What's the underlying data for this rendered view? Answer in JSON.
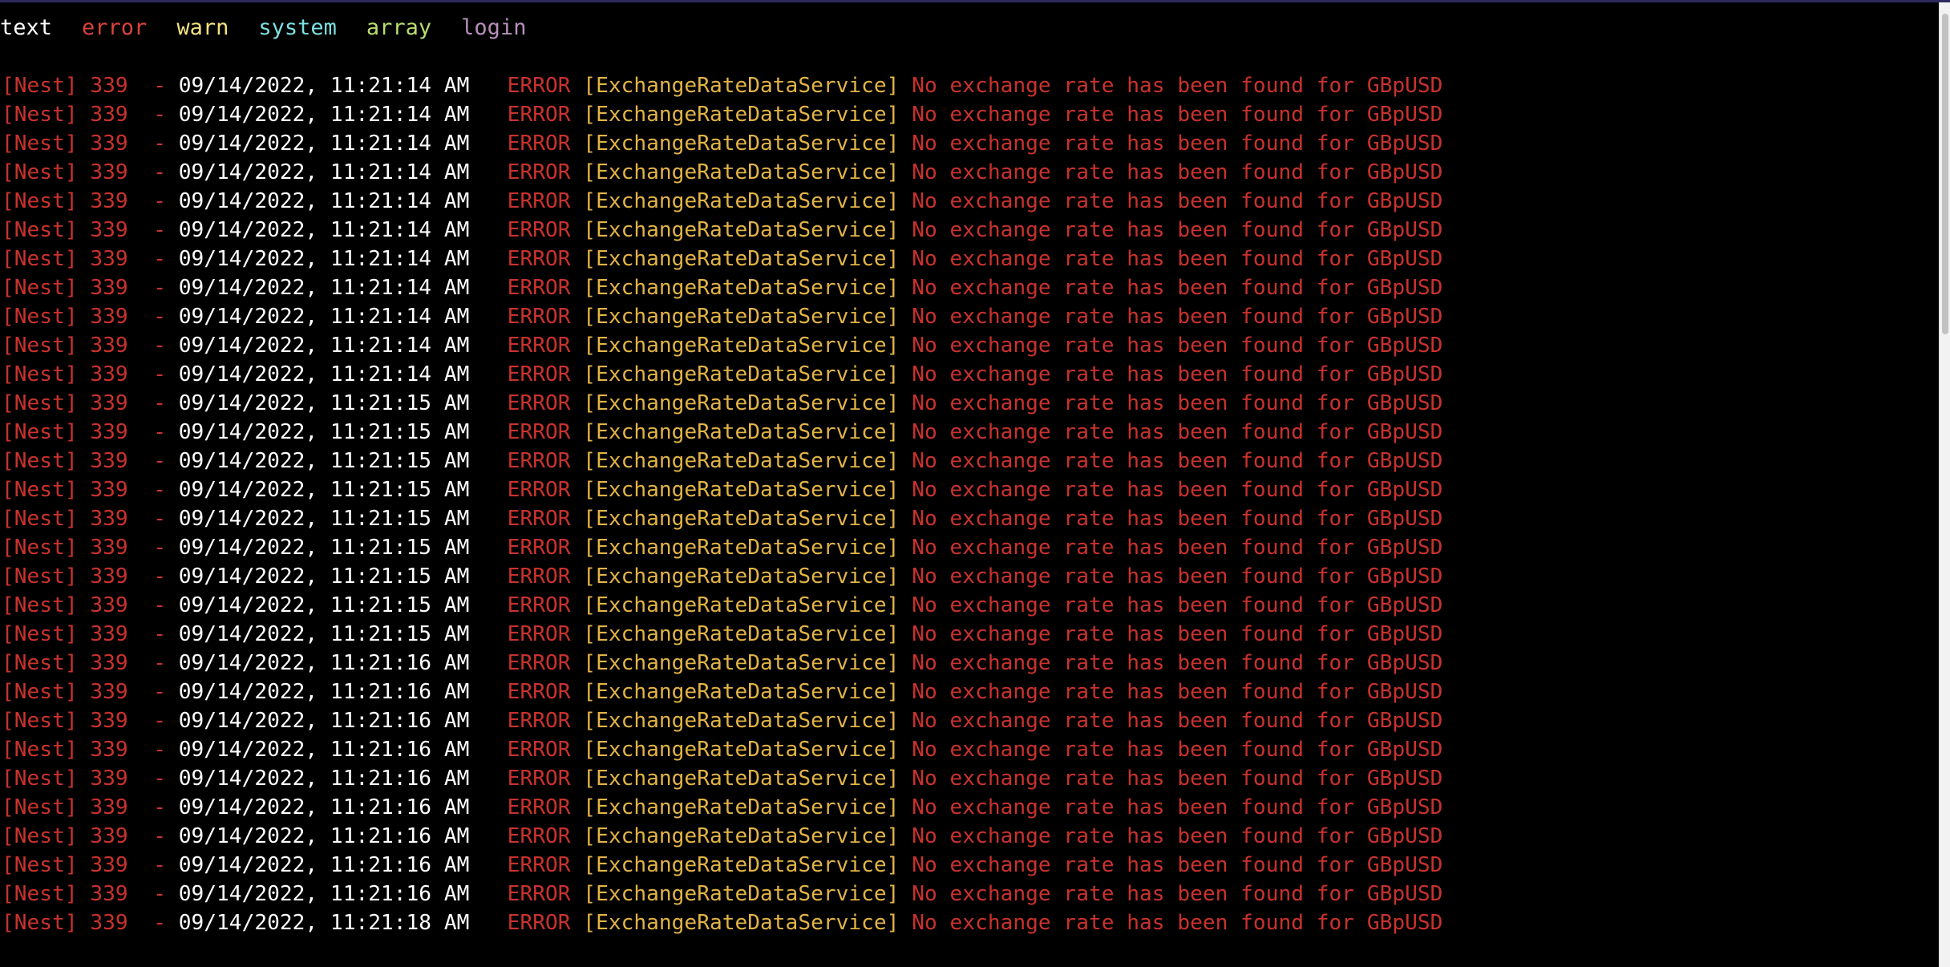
{
  "filters": [
    {
      "label": "text",
      "color": "#ffffff"
    },
    {
      "label": "error",
      "color": "#d9433c"
    },
    {
      "label": "warn",
      "color": "#f3e27f"
    },
    {
      "label": "system",
      "color": "#7ee0e0"
    },
    {
      "label": "array",
      "color": "#b6dd6f"
    },
    {
      "label": "login",
      "color": "#b690bb"
    }
  ],
  "colors": {
    "background": "#000000",
    "prefix": "#c9322e",
    "timestamp": "#ffffff",
    "level": "#c9322e",
    "context": "#e2b446",
    "message": "#c9322e"
  },
  "log_lines": [
    {
      "prefix": "[Nest] 339  - ",
      "timestamp": "09/14/2022, 11:21:14 AM",
      "level": "ERROR",
      "context": "[ExchangeRateDataService]",
      "message": "No exchange rate has been found for GBpUSD"
    },
    {
      "prefix": "[Nest] 339  - ",
      "timestamp": "09/14/2022, 11:21:14 AM",
      "level": "ERROR",
      "context": "[ExchangeRateDataService]",
      "message": "No exchange rate has been found for GBpUSD"
    },
    {
      "prefix": "[Nest] 339  - ",
      "timestamp": "09/14/2022, 11:21:14 AM",
      "level": "ERROR",
      "context": "[ExchangeRateDataService]",
      "message": "No exchange rate has been found for GBpUSD"
    },
    {
      "prefix": "[Nest] 339  - ",
      "timestamp": "09/14/2022, 11:21:14 AM",
      "level": "ERROR",
      "context": "[ExchangeRateDataService]",
      "message": "No exchange rate has been found for GBpUSD"
    },
    {
      "prefix": "[Nest] 339  - ",
      "timestamp": "09/14/2022, 11:21:14 AM",
      "level": "ERROR",
      "context": "[ExchangeRateDataService]",
      "message": "No exchange rate has been found for GBpUSD"
    },
    {
      "prefix": "[Nest] 339  - ",
      "timestamp": "09/14/2022, 11:21:14 AM",
      "level": "ERROR",
      "context": "[ExchangeRateDataService]",
      "message": "No exchange rate has been found for GBpUSD"
    },
    {
      "prefix": "[Nest] 339  - ",
      "timestamp": "09/14/2022, 11:21:14 AM",
      "level": "ERROR",
      "context": "[ExchangeRateDataService]",
      "message": "No exchange rate has been found for GBpUSD"
    },
    {
      "prefix": "[Nest] 339  - ",
      "timestamp": "09/14/2022, 11:21:14 AM",
      "level": "ERROR",
      "context": "[ExchangeRateDataService]",
      "message": "No exchange rate has been found for GBpUSD"
    },
    {
      "prefix": "[Nest] 339  - ",
      "timestamp": "09/14/2022, 11:21:14 AM",
      "level": "ERROR",
      "context": "[ExchangeRateDataService]",
      "message": "No exchange rate has been found for GBpUSD"
    },
    {
      "prefix": "[Nest] 339  - ",
      "timestamp": "09/14/2022, 11:21:14 AM",
      "level": "ERROR",
      "context": "[ExchangeRateDataService]",
      "message": "No exchange rate has been found for GBpUSD"
    },
    {
      "prefix": "[Nest] 339  - ",
      "timestamp": "09/14/2022, 11:21:14 AM",
      "level": "ERROR",
      "context": "[ExchangeRateDataService]",
      "message": "No exchange rate has been found for GBpUSD"
    },
    {
      "prefix": "[Nest] 339  - ",
      "timestamp": "09/14/2022, 11:21:15 AM",
      "level": "ERROR",
      "context": "[ExchangeRateDataService]",
      "message": "No exchange rate has been found for GBpUSD"
    },
    {
      "prefix": "[Nest] 339  - ",
      "timestamp": "09/14/2022, 11:21:15 AM",
      "level": "ERROR",
      "context": "[ExchangeRateDataService]",
      "message": "No exchange rate has been found for GBpUSD"
    },
    {
      "prefix": "[Nest] 339  - ",
      "timestamp": "09/14/2022, 11:21:15 AM",
      "level": "ERROR",
      "context": "[ExchangeRateDataService]",
      "message": "No exchange rate has been found for GBpUSD"
    },
    {
      "prefix": "[Nest] 339  - ",
      "timestamp": "09/14/2022, 11:21:15 AM",
      "level": "ERROR",
      "context": "[ExchangeRateDataService]",
      "message": "No exchange rate has been found for GBpUSD"
    },
    {
      "prefix": "[Nest] 339  - ",
      "timestamp": "09/14/2022, 11:21:15 AM",
      "level": "ERROR",
      "context": "[ExchangeRateDataService]",
      "message": "No exchange rate has been found for GBpUSD"
    },
    {
      "prefix": "[Nest] 339  - ",
      "timestamp": "09/14/2022, 11:21:15 AM",
      "level": "ERROR",
      "context": "[ExchangeRateDataService]",
      "message": "No exchange rate has been found for GBpUSD"
    },
    {
      "prefix": "[Nest] 339  - ",
      "timestamp": "09/14/2022, 11:21:15 AM",
      "level": "ERROR",
      "context": "[ExchangeRateDataService]",
      "message": "No exchange rate has been found for GBpUSD"
    },
    {
      "prefix": "[Nest] 339  - ",
      "timestamp": "09/14/2022, 11:21:15 AM",
      "level": "ERROR",
      "context": "[ExchangeRateDataService]",
      "message": "No exchange rate has been found for GBpUSD"
    },
    {
      "prefix": "[Nest] 339  - ",
      "timestamp": "09/14/2022, 11:21:15 AM",
      "level": "ERROR",
      "context": "[ExchangeRateDataService]",
      "message": "No exchange rate has been found for GBpUSD"
    },
    {
      "prefix": "[Nest] 339  - ",
      "timestamp": "09/14/2022, 11:21:16 AM",
      "level": "ERROR",
      "context": "[ExchangeRateDataService]",
      "message": "No exchange rate has been found for GBpUSD"
    },
    {
      "prefix": "[Nest] 339  - ",
      "timestamp": "09/14/2022, 11:21:16 AM",
      "level": "ERROR",
      "context": "[ExchangeRateDataService]",
      "message": "No exchange rate has been found for GBpUSD"
    },
    {
      "prefix": "[Nest] 339  - ",
      "timestamp": "09/14/2022, 11:21:16 AM",
      "level": "ERROR",
      "context": "[ExchangeRateDataService]",
      "message": "No exchange rate has been found for GBpUSD"
    },
    {
      "prefix": "[Nest] 339  - ",
      "timestamp": "09/14/2022, 11:21:16 AM",
      "level": "ERROR",
      "context": "[ExchangeRateDataService]",
      "message": "No exchange rate has been found for GBpUSD"
    },
    {
      "prefix": "[Nest] 339  - ",
      "timestamp": "09/14/2022, 11:21:16 AM",
      "level": "ERROR",
      "context": "[ExchangeRateDataService]",
      "message": "No exchange rate has been found for GBpUSD"
    },
    {
      "prefix": "[Nest] 339  - ",
      "timestamp": "09/14/2022, 11:21:16 AM",
      "level": "ERROR",
      "context": "[ExchangeRateDataService]",
      "message": "No exchange rate has been found for GBpUSD"
    },
    {
      "prefix": "[Nest] 339  - ",
      "timestamp": "09/14/2022, 11:21:16 AM",
      "level": "ERROR",
      "context": "[ExchangeRateDataService]",
      "message": "No exchange rate has been found for GBpUSD"
    },
    {
      "prefix": "[Nest] 339  - ",
      "timestamp": "09/14/2022, 11:21:16 AM",
      "level": "ERROR",
      "context": "[ExchangeRateDataService]",
      "message": "No exchange rate has been found for GBpUSD"
    },
    {
      "prefix": "[Nest] 339  - ",
      "timestamp": "09/14/2022, 11:21:16 AM",
      "level": "ERROR",
      "context": "[ExchangeRateDataService]",
      "message": "No exchange rate has been found for GBpUSD"
    },
    {
      "prefix": "[Nest] 339  - ",
      "timestamp": "09/14/2022, 11:21:18 AM",
      "level": "ERROR",
      "context": "[ExchangeRateDataService]",
      "message": "No exchange rate has been found for GBpUSD"
    }
  ]
}
